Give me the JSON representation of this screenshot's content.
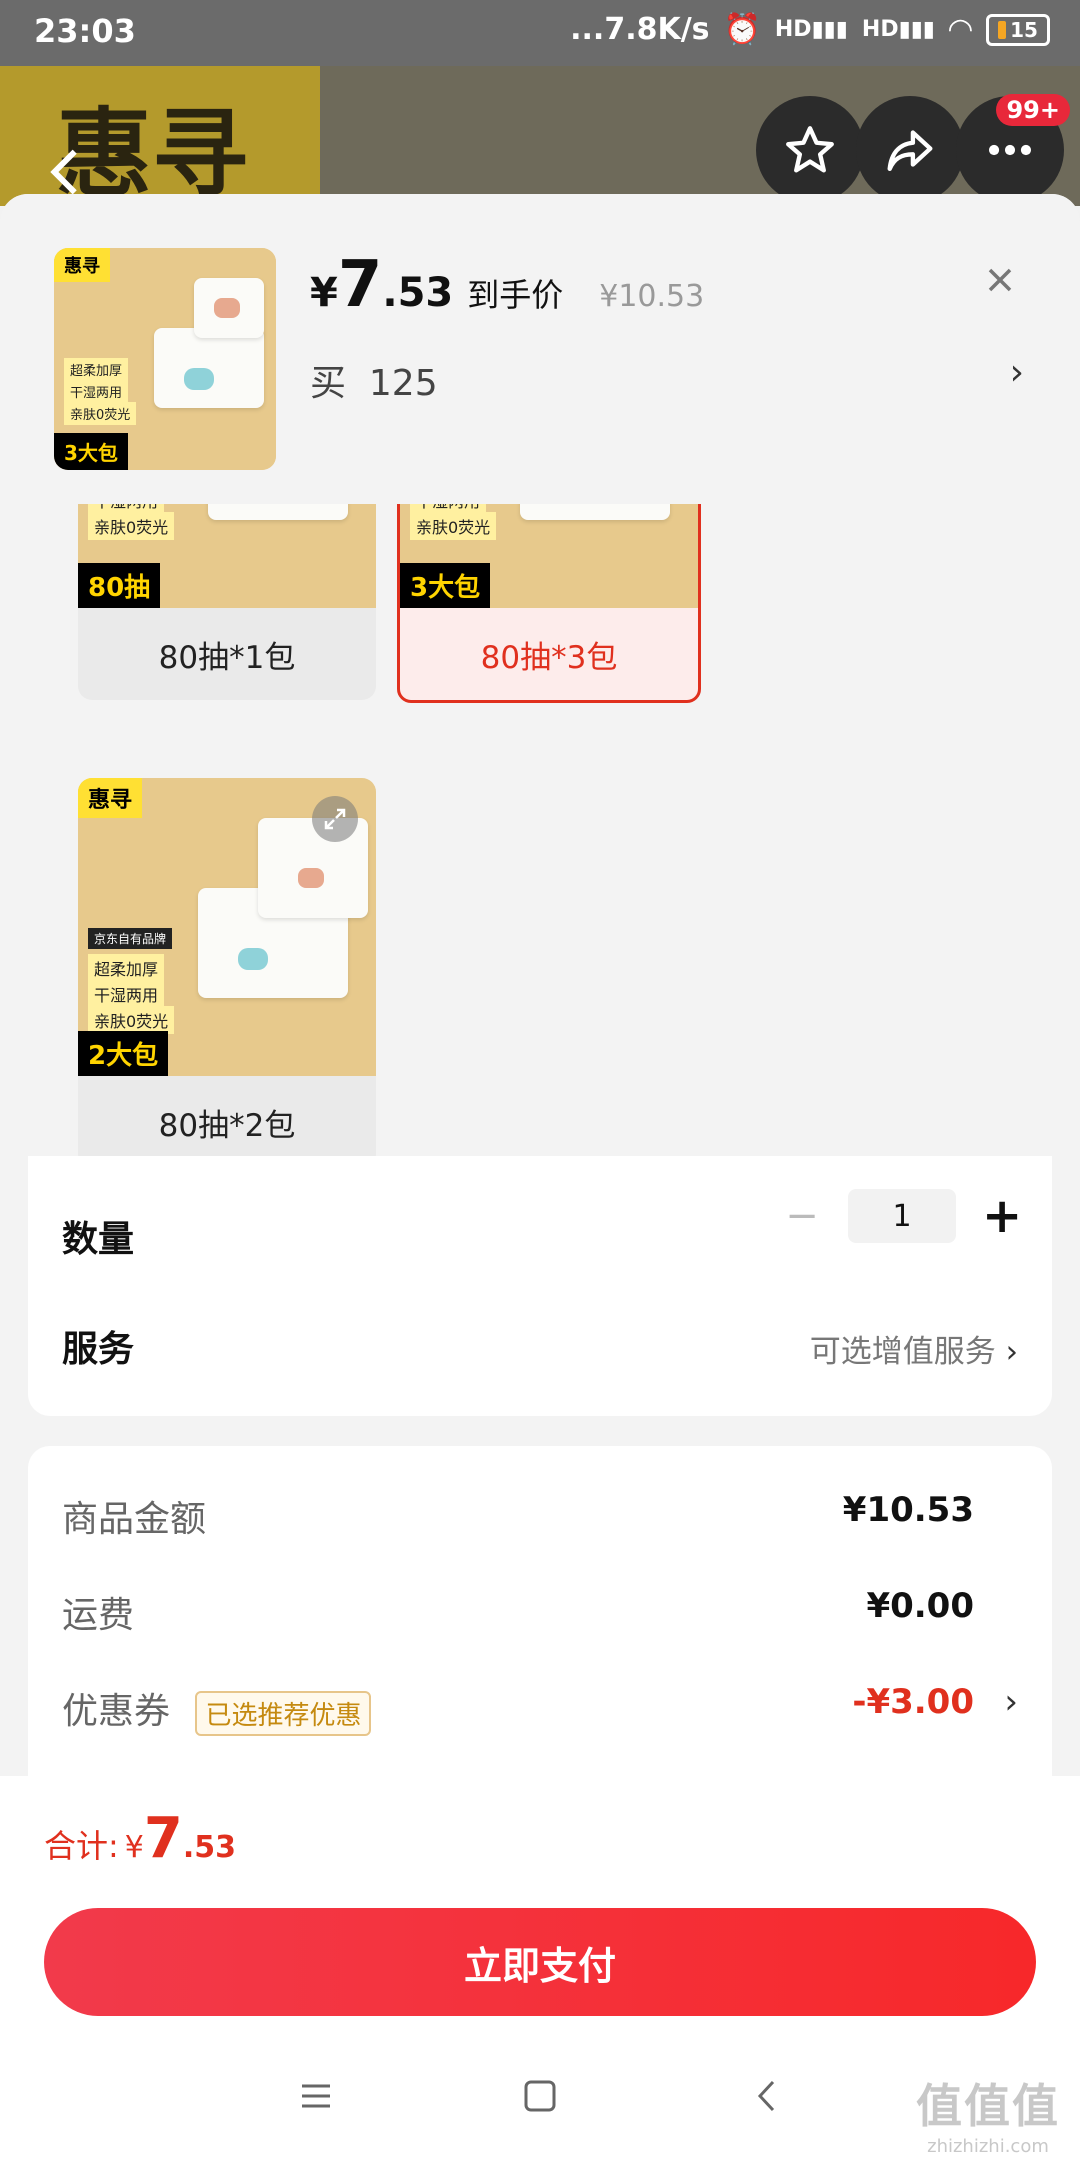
{
  "status_bar": {
    "time": "23:03",
    "network_speed": "...7.8K/s",
    "signal_1": "HD",
    "signal_2": "HD",
    "battery": "15"
  },
  "header": {
    "brand": "惠寻",
    "notification_badge": "99+"
  },
  "product": {
    "price_currency": "¥",
    "price_int": "7",
    "price_dec": ".53",
    "after_label": "到手价",
    "original_price": "¥10.53",
    "buy_label": "买",
    "buy_value": "125",
    "thumb": {
      "brand_tag": "惠寻",
      "promo_1": "超柔加厚",
      "promo_2": "干湿两用",
      "promo_3": "亲肤0荧光",
      "pack": "3大包"
    }
  },
  "variants": [
    {
      "label": "80抽*1包",
      "pack": "80抽",
      "selected": false
    },
    {
      "label": "80抽*3包",
      "pack": "3大包",
      "selected": true
    },
    {
      "label": "80抽*2包",
      "pack": "2大包",
      "selected": false
    }
  ],
  "variant_image": {
    "brand_tag": "惠寻",
    "store": "京东自有品牌",
    "promo_1": "超柔加厚",
    "promo_2": "干湿两用",
    "promo_3": "亲肤0荧光"
  },
  "quantity": {
    "label": "数量",
    "value": "1",
    "minus": "−",
    "plus": "+"
  },
  "service": {
    "label": "服务",
    "value": "可选增值服务"
  },
  "summary": {
    "goods_label": "商品金额",
    "goods_value": "¥10.53",
    "shipping_label": "运费",
    "shipping_value": "¥0.00",
    "coupon_label": "优惠券",
    "coupon_tag": "已选推荐优惠",
    "coupon_value": "-¥3.00"
  },
  "total": {
    "label": "合计:",
    "currency": "¥",
    "int": "7",
    "dec": ".53"
  },
  "pay_button": "立即支付",
  "watermark": {
    "big": "值值值",
    "small": "zhizhizhi.com"
  },
  "colors": {
    "accent": "#e0301e",
    "pay_start": "#f23a4b",
    "pay_end": "#f7282a"
  }
}
